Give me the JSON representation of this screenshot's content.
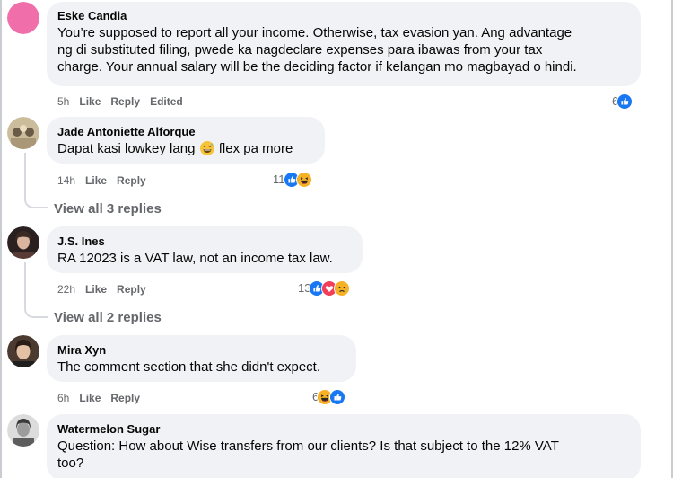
{
  "comments": [
    {
      "name": "Eske Candia",
      "lines": [
        "You’re supposed to report all your income. Otherwise, tax evasion yan. Ang advantage",
        "ng di substituted filing, pwede ka nagdeclare expenses para ibawas from your tax",
        "charge. Your annual salary will be the deciding factor if kelangan mo magbayad o hindi."
      ],
      "time": "5h",
      "like": "Like",
      "reply": "Reply",
      "edited": "Edited",
      "reaction_count": "6"
    },
    {
      "name": "Jade Antoniette Alforque",
      "text_before": "Dapat kasi lowkey lang",
      "text_after": "flex pa more",
      "time": "14h",
      "like": "Like",
      "reply": "Reply",
      "reaction_count": "11",
      "view_replies": "View all 3 replies"
    },
    {
      "name": "J.S. Ines",
      "text": "RA 12023 is a VAT law, not an income tax law.",
      "time": "22h",
      "like": "Like",
      "reply": "Reply",
      "reaction_count": "13",
      "view_replies": "View all 2 replies"
    },
    {
      "name": "Mira Xyn",
      "text": "The comment section that she didn't expect.",
      "time": "6h",
      "like": "Like",
      "reply": "Reply",
      "reaction_count": "6"
    },
    {
      "name": "Watermelon Sugar",
      "lines": [
        "Question: How about Wise transfers from our clients? Is that subject to the 12% VAT",
        "too?"
      ]
    }
  ],
  "icons": {
    "like": "like-reaction-icon",
    "haha": "haha-reaction-icon",
    "love": "love-reaction-icon",
    "sad": "sad-reaction-icon",
    "grin": "grinning-sweat-emoji"
  },
  "colors": {
    "bubble": "#f0f2f5",
    "meta": "#65676b",
    "like_blue": "#1877f2",
    "love_red": "#f33e58",
    "haha_yellow": "#f7b125"
  }
}
